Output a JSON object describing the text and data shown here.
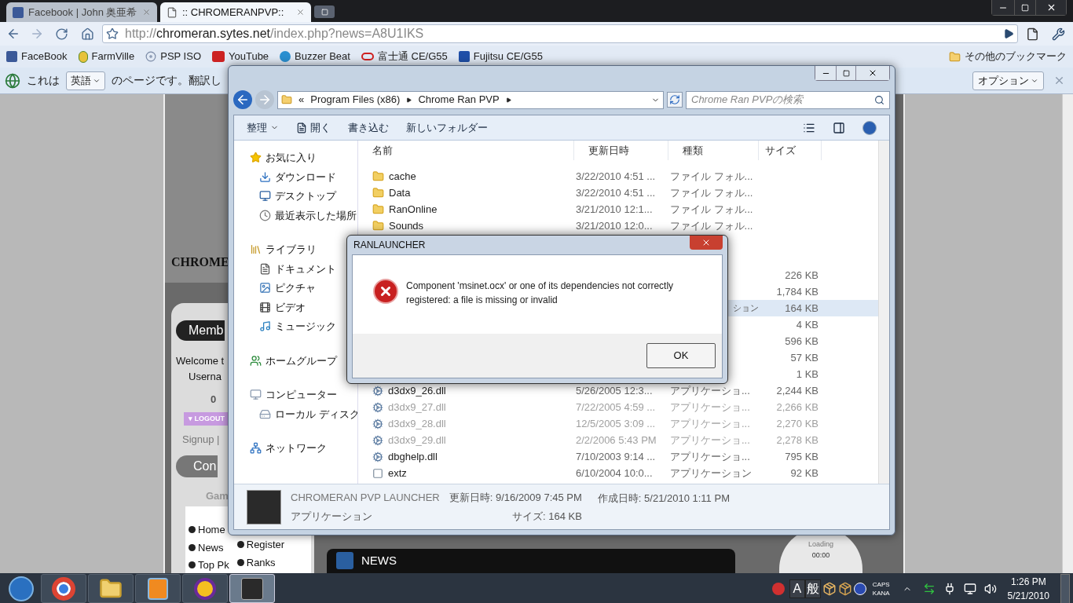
{
  "browser": {
    "tabs": [
      {
        "title": "Facebook | John 奥亜希",
        "kind": "facebook",
        "selected": false
      },
      {
        "title": ":: CHROMERANPVP::",
        "kind": "page",
        "selected": true
      }
    ],
    "url": {
      "scheme": "http://",
      "host": "chromeran.sytes.net",
      "path": "/index.php?news=A8U1IKS"
    },
    "bookmarks": [
      {
        "label": "FaceBook",
        "kind": "facebook"
      },
      {
        "label": "FarmVille",
        "kind": "corn"
      },
      {
        "label": "PSP ISO",
        "kind": "disc"
      },
      {
        "label": "YouTube",
        "kind": "video"
      },
      {
        "label": "Buzzer Beat",
        "kind": "play"
      },
      {
        "label": "富士通 CE/G55",
        "kind": "ring"
      },
      {
        "label": "Fujitsu CE/G55",
        "kind": "price"
      }
    ],
    "other_bookmarks": "その他のブックマーク",
    "translate_bar": {
      "prefix": "これは",
      "language": "英語",
      "suffix": "のページです。翻訳し",
      "options": "オプション"
    }
  },
  "website": {
    "logo_text": "CHROME",
    "member_button": "Memb",
    "welcome": "Welcome t",
    "username": "Userna",
    "count": "0",
    "logout": "▾ LOGOUT",
    "signup": "Signup | ",
    "control_button": "Con",
    "game_heading": "Gam",
    "menu_left": [
      "Home",
      "News",
      "Top Pk"
    ],
    "menu_right": [
      "Register",
      "Ranks"
    ],
    "news_heading": "NEWS",
    "player_status": "Loading",
    "player_time": "00:00"
  },
  "explorer": {
    "overflow_mark": "«",
    "breadcrumb": [
      "Program Files (x86)",
      "Chrome Ran PVP"
    ],
    "search_placeholder": "Chrome Ran PVPの検索",
    "toolbar": [
      {
        "label": "整理",
        "kind": "menu"
      },
      {
        "label": "開く",
        "kind": "open"
      },
      {
        "label": "書き込む",
        "kind": "plain"
      },
      {
        "label": "新しいフォルダー",
        "kind": "plain"
      }
    ],
    "columns": [
      "名前",
      "更新日時",
      "種類",
      "サイズ"
    ],
    "nav": [
      {
        "label": "お気に入り",
        "kind": "star",
        "children": [
          {
            "label": "ダウンロード",
            "kind": "download"
          },
          {
            "label": "デスクトップ",
            "kind": "desktop"
          },
          {
            "label": "最近表示した場所",
            "kind": "recent"
          }
        ]
      },
      {
        "label": "ライブラリ",
        "kind": "library",
        "children": [
          {
            "label": "ドキュメント",
            "kind": "document"
          },
          {
            "label": "ピクチャ",
            "kind": "picture"
          },
          {
            "label": "ビデオ",
            "kind": "video"
          },
          {
            "label": "ミュージック",
            "kind": "music"
          }
        ]
      },
      {
        "label": "ホームグループ",
        "kind": "homegroup"
      },
      {
        "label": "コンピューター",
        "kind": "computer",
        "children": [
          {
            "label": "ローカル ディスク",
            "kind": "disk"
          }
        ]
      },
      {
        "label": "ネットワーク",
        "kind": "network"
      }
    ],
    "rows": [
      {
        "name": "cache",
        "date": "3/22/2010 4:51 ...",
        "type": "ファイル フォル...",
        "kind": "folder",
        "selected": false,
        "dimmed": false
      },
      {
        "name": "Data",
        "date": "3/22/2010 4:51 ...",
        "type": "ファイル フォル...",
        "kind": "folder",
        "selected": false,
        "dimmed": false
      },
      {
        "name": "RanOnline",
        "date": "3/21/2010 12:1...",
        "type": "ファイル フォル...",
        "kind": "folder",
        "selected": false,
        "dimmed": false
      },
      {
        "name": "Sounds",
        "date": "3/21/2010 12:0...",
        "type": "ファイル フォル...",
        "kind": "folder",
        "selected": false,
        "dimmed": false
      },
      {
        "selected": false
      },
      {
        "selected": false
      },
      {
        "size": "226 KB",
        "selected": false,
        "dimmed": false
      },
      {
        "size": "1,784 KB",
        "selected": false,
        "dimmed": false
      },
      {
        "type": "ション",
        "size": "164 KB",
        "selected": true,
        "dimmed": false
      },
      {
        "size": "4 KB",
        "selected": false,
        "dimmed": false
      },
      {
        "size": "596 KB",
        "selected": false,
        "dimmed": false
      },
      {
        "size": "57 KB",
        "selected": false,
        "dimmed": false
      },
      {
        "size": "1 KB",
        "selected": false,
        "dimmed": false
      },
      {
        "name": "d3dx9_26.dll",
        "date": "5/26/2005 12:3...",
        "type": "アプリケーショ...",
        "size": "2,244 KB",
        "kind": "dll",
        "selected": false,
        "dimmed": false
      },
      {
        "name": "d3dx9_27.dll",
        "date": "7/22/2005 4:59 ...",
        "type": "アプリケーショ...",
        "size": "2,266 KB",
        "kind": "dll",
        "selected": false,
        "dimmed": true
      },
      {
        "name": "d3dx9_28.dll",
        "date": "12/5/2005 3:09 ...",
        "type": "アプリケーショ...",
        "size": "2,270 KB",
        "kind": "dll",
        "selected": false,
        "dimmed": true
      },
      {
        "name": "d3dx9_29.dll",
        "date": "2/2/2006 5:43 PM",
        "type": "アプリケーショ...",
        "size": "2,278 KB",
        "kind": "dll",
        "selected": false,
        "dimmed": true
      },
      {
        "name": "dbghelp.dll",
        "date": "7/10/2003 9:14 ...",
        "type": "アプリケーショ...",
        "size": "795 KB",
        "kind": "dll",
        "selected": false,
        "dimmed": false
      },
      {
        "name": "extz",
        "date": "6/10/2004 10:0...",
        "type": "アプリケーション",
        "size": "92 KB",
        "kind": "app",
        "selected": false,
        "dimmed": false
      }
    ],
    "details": {
      "name": "CHROMERAN PVP LAUNCHER",
      "modified": "更新日時: 9/16/2009 7:45 PM",
      "created": "作成日時: 5/21/2010 1:11 PM",
      "type": "アプリケーション",
      "size": "サイズ: 164 KB"
    }
  },
  "dialog": {
    "title": "RANLAUNCHER",
    "message": "Component 'msinet.ocx' or one of its dependencies not correctly registered: a file is missing or invalid",
    "button": "OK"
  },
  "taskbar": {
    "apps": [
      {
        "kind": "chrome",
        "selected": false
      },
      {
        "kind": "explorer",
        "selected": false
      },
      {
        "kind": "media",
        "selected": false
      },
      {
        "kind": "messenger",
        "selected": false
      },
      {
        "kind": "ran",
        "selected": true
      }
    ],
    "ime": [
      "A",
      "般"
    ],
    "keys": [
      "CAPS",
      "KANA"
    ],
    "time": "1:26 PM",
    "date": "5/21/2010"
  }
}
